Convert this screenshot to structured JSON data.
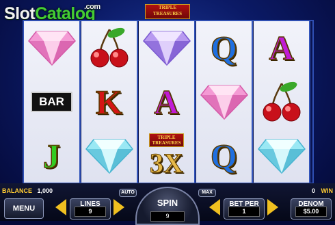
{
  "watermark": {
    "part1": "Slot",
    "part2": "Catalog",
    "suffix": ".com"
  },
  "game_logo": {
    "line1": "TRIPLE",
    "line2": "TREASURES"
  },
  "reels": [
    [
      {
        "type": "diamond",
        "color": "pink"
      },
      {
        "type": "bar",
        "label": "BAR"
      },
      {
        "type": "letter",
        "label": "J",
        "color": "#33cc22"
      }
    ],
    [
      {
        "type": "cherry"
      },
      {
        "type": "letter",
        "label": "K",
        "color": "#d41515"
      },
      {
        "type": "diamond",
        "color": "cyan"
      }
    ],
    [
      {
        "type": "diamond",
        "color": "purple"
      },
      {
        "type": "letter",
        "label": "A",
        "color": "#c01bd6"
      },
      {
        "type": "multiplier",
        "label": "3X",
        "logo_line1": "TRIPLE",
        "logo_line2": "TREASURES"
      }
    ],
    [
      {
        "type": "letter",
        "label": "Q",
        "color": "#1f6fe0"
      },
      {
        "type": "diamond",
        "color": "pink"
      },
      {
        "type": "letter",
        "label": "Q",
        "color": "#1f6fe0"
      }
    ],
    [
      {
        "type": "letter",
        "label": "A",
        "color": "#c01bd6"
      },
      {
        "type": "cherry"
      },
      {
        "type": "diamond",
        "color": "cyan"
      }
    ]
  ],
  "status": {
    "balance_label": "BALANCE",
    "balance": "1,000",
    "win": "0",
    "win_label": "WIN"
  },
  "controls": {
    "menu": "MENU",
    "lines_label": "LINES",
    "lines_value": "9",
    "auto": "AUTO",
    "spin": "SPIN",
    "spin_value": "9",
    "max": "MAX",
    "bet_label": "BET PER",
    "bet_value": "1",
    "denom_label": "DENOM",
    "denom_value": "$5.00"
  },
  "colors": {
    "gold_arrow": "#f0c020",
    "reel_border": "#3355bb"
  }
}
